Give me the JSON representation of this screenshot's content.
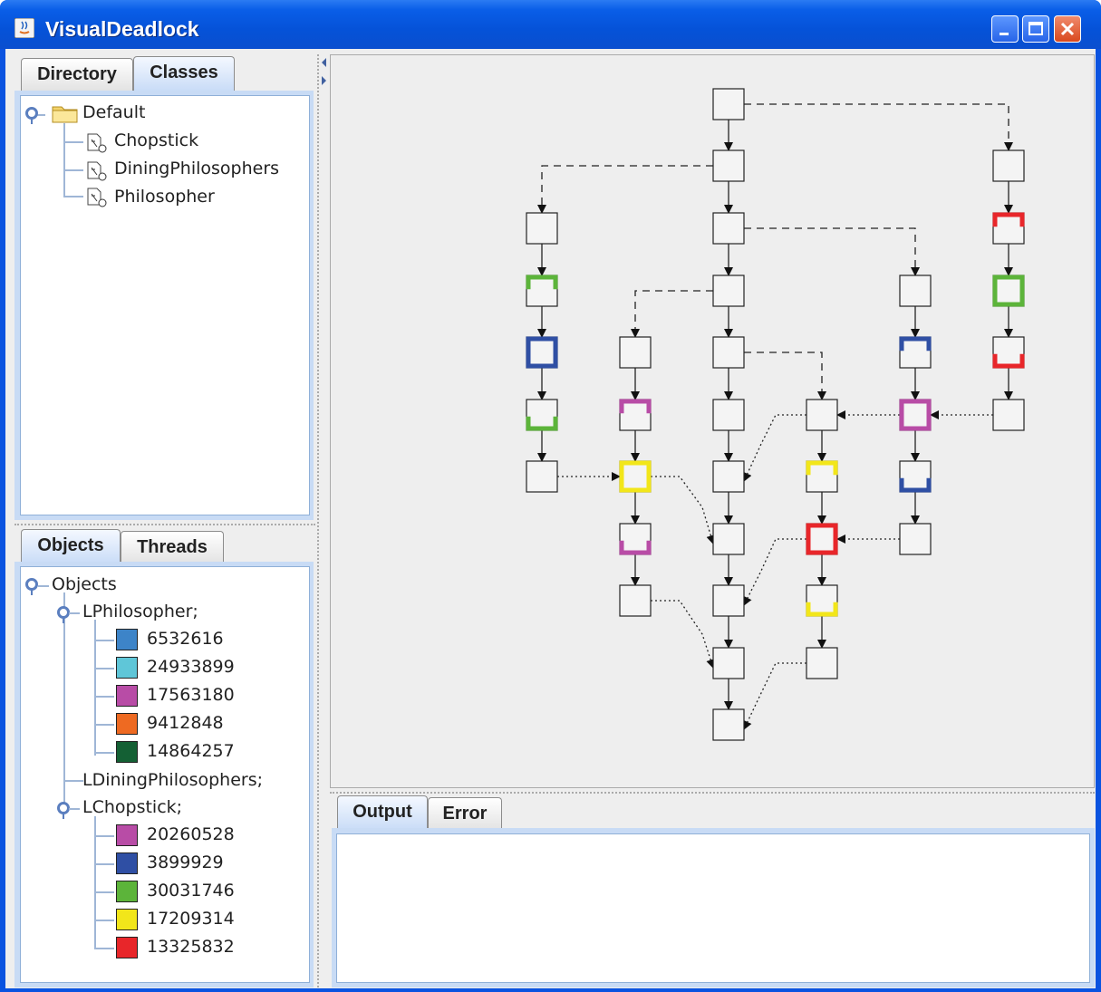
{
  "window": {
    "title": "VisualDeadlock"
  },
  "top_tabs": [
    "Directory",
    "Classes"
  ],
  "class_tree": {
    "root": "Default",
    "children": [
      "Chopstick",
      "DiningPhilosophers",
      "Philosopher"
    ]
  },
  "object_tabs": [
    "Objects",
    "Threads"
  ],
  "object_tree": {
    "root": "Objects",
    "philosopher_label": "LPhilosopher;",
    "philosophers": [
      {
        "id": "6532616",
        "color": "#3d84c8"
      },
      {
        "id": "24933899",
        "color": "#5fc6d8"
      },
      {
        "id": "17563180",
        "color": "#b84ca6"
      },
      {
        "id": "9412848",
        "color": "#ee6a22"
      },
      {
        "id": "14864257",
        "color": "#146034"
      }
    ],
    "dining_label": "LDiningPhilosophers;",
    "chopstick_label": "LChopstick;",
    "chopsticks": [
      {
        "id": "20260528",
        "color": "#b84ca6"
      },
      {
        "id": "3899929",
        "color": "#2f4fa4"
      },
      {
        "id": "30031746",
        "color": "#5cb43a"
      },
      {
        "id": "17209314",
        "color": "#f2e61a"
      },
      {
        "id": "13325832",
        "color": "#e8262a"
      }
    ]
  },
  "output_tabs": [
    "Output",
    "Error"
  ]
}
